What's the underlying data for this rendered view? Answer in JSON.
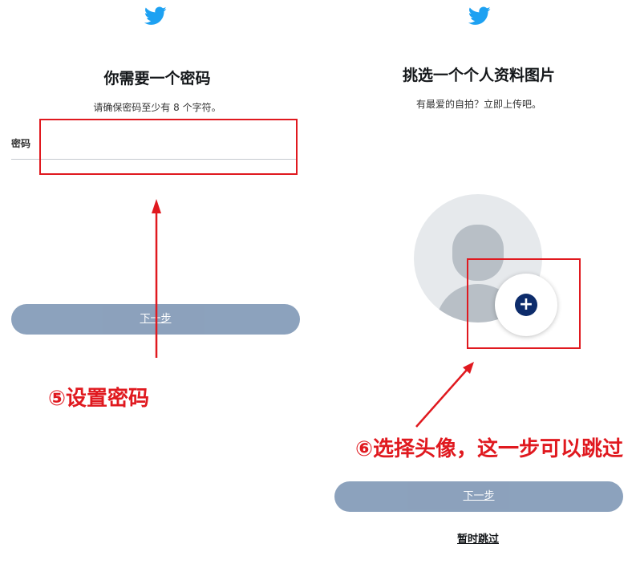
{
  "colors": {
    "accent_red": "#e0191f",
    "button_blue": "#869db9",
    "twitter_blue": "#1da1f2",
    "plus_navy": "#0d2c6b"
  },
  "left": {
    "bird_icon": "twitter-bird-icon",
    "title": "你需要一个密码",
    "subtitle": "请确保密码至少有 8 个字符。",
    "field_label": "密码",
    "field_value": "",
    "next_label": "下一步",
    "caption_num": "⑤",
    "caption_text": "设置密码"
  },
  "right": {
    "bird_icon": "twitter-bird-icon",
    "title": "挑选一个个人资料图片",
    "subtitle": "有最爱的自拍？立即上传吧。",
    "plus_icon": "+",
    "next_label": "下一步",
    "skip_label": "暂时跳过",
    "caption_num": "⑥",
    "caption_text": "选择头像，这一步可以跳过"
  }
}
